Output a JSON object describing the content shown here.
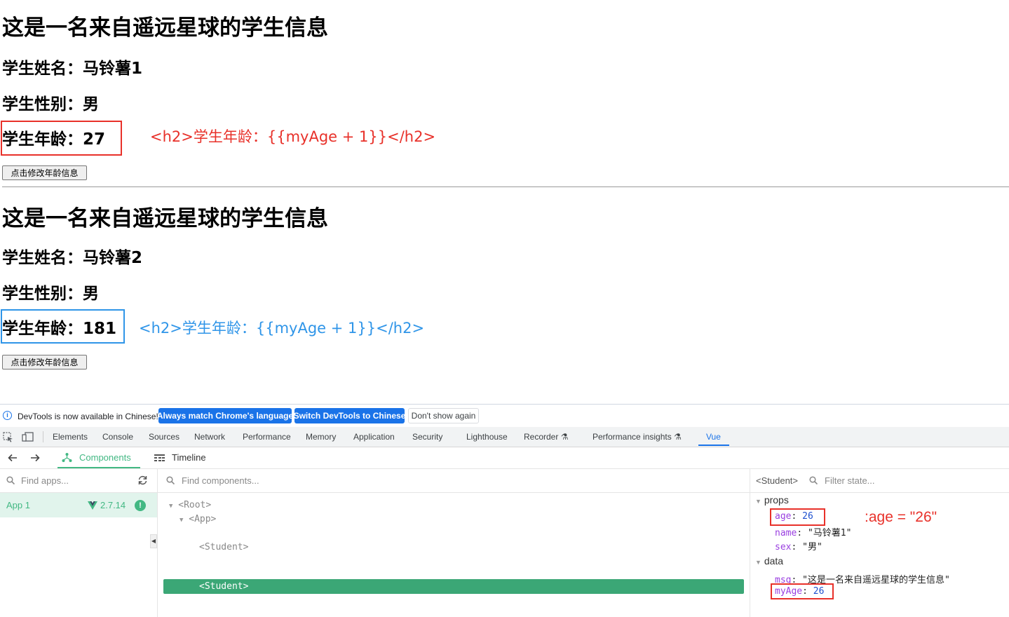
{
  "student1": {
    "title": "这是一名来自遥远星球的学生信息",
    "name_line": "学生姓名：马铃薯1",
    "sex_line": "学生性别：男",
    "age_line": "学生年龄：27",
    "button": "点击修改年龄信息",
    "annotation": "<h2>学生年龄：{{myAge + 1}}</h2>"
  },
  "student2": {
    "title": "这是一名来自遥远星球的学生信息",
    "name_line": "学生姓名：马铃薯2",
    "sex_line": "学生性别：男",
    "age_line": "学生年龄：181",
    "button": "点击修改年龄信息",
    "annotation": "<h2>学生年龄：{{myAge + 1}}</h2>"
  },
  "colors": {
    "annotation_red": "#e8312a",
    "annotation_blue": "#2f95e8",
    "vue_green": "#42b883",
    "chrome_blue": "#1a73e8"
  },
  "devtools": {
    "infobar": {
      "message": "DevTools is now available in Chinese!",
      "btn_match": "Always match Chrome's language",
      "btn_switch": "Switch DevTools to Chinese",
      "btn_dont_show": "Don't show again"
    },
    "tabs": [
      "Elements",
      "Console",
      "Sources",
      "Network",
      "Performance",
      "Memory",
      "Application",
      "Security",
      "Lighthouse",
      "Recorder",
      "Performance insights",
      "Vue"
    ],
    "active_tab": "Vue",
    "vue_nav": {
      "components": "Components",
      "timeline": "Timeline"
    },
    "apps": {
      "search_placeholder": "Find apps...",
      "app_name": "App 1",
      "version": "2.7.14"
    },
    "components": {
      "search_placeholder": "Find components...",
      "tree": [
        "<Root>",
        "<App>",
        "<Student>",
        "<Student>"
      ]
    },
    "state": {
      "selected": "<Student>",
      "filter_placeholder": "Filter state...",
      "props_label": "props",
      "props": [
        {
          "key": "age",
          "value": "26"
        },
        {
          "key": "name",
          "value": "\"马铃薯1\""
        },
        {
          "key": "sex",
          "value": "\"男\""
        }
      ],
      "data_label": "data",
      "data": [
        {
          "key": "msg",
          "value": "\"这是一名来自遥远星球的学生信息\""
        },
        {
          "key": "myAge",
          "value": "26"
        }
      ],
      "annotation": ":age = \"26\""
    }
  }
}
